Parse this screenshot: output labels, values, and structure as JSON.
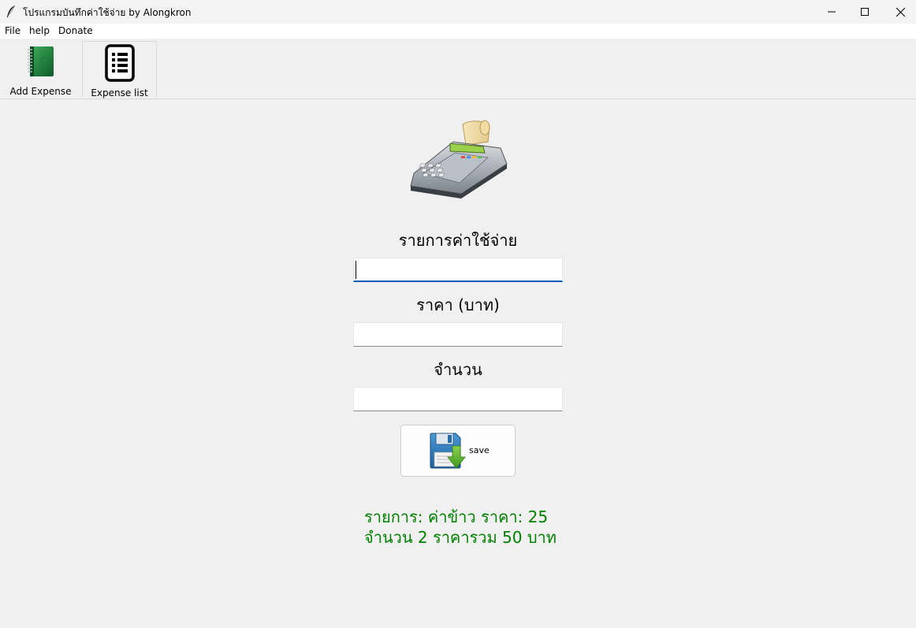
{
  "window": {
    "title": "โปรแกรมบันทึกค่าใช้จ่าย by Alongkron",
    "icon": "feather-icon",
    "controls": [
      "minimize-icon",
      "maximize-icon",
      "close-icon"
    ]
  },
  "menu": {
    "file": "File",
    "help": "help",
    "donate": "Donate"
  },
  "tabs": [
    {
      "label": "Add Expense",
      "icon": "green-notebook-icon",
      "selected": true
    },
    {
      "label": "Expense list",
      "icon": "list-document-icon",
      "selected": false
    }
  ],
  "form": {
    "image": "cash-register-image",
    "item_label": "รายการค่าใช้จ่าย",
    "item_value": "",
    "price_label": "ราคา (บาท)",
    "price_value": "",
    "quantity_label": "จำนวน",
    "quantity_value": "",
    "save_label": "save",
    "save_icon": "floppy-disk-download-icon"
  },
  "result": {
    "line1": "รายการ: ค่าข้าว ราคา: 25",
    "line2": "จำนวน 2 ราคารวม 50 บาท",
    "color": "#008000"
  },
  "colors": {
    "background": "#f0f0f0",
    "focus_accent": "#005fb8"
  }
}
